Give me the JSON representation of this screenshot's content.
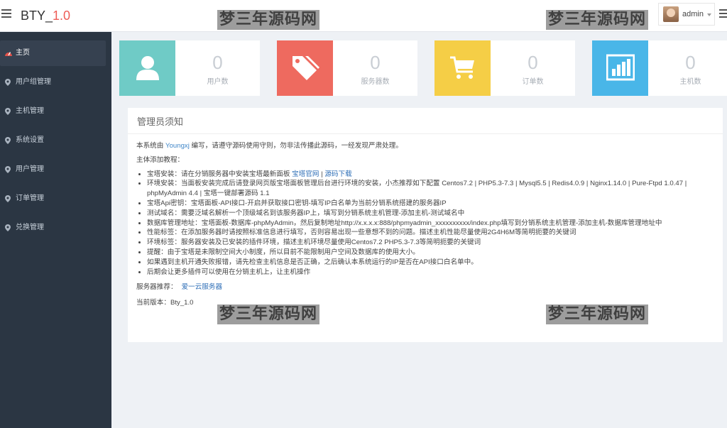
{
  "brand": {
    "name": "BTY_",
    "version": "1.0"
  },
  "user": {
    "name": "admin"
  },
  "watermark": "梦三年源码网",
  "sidebar": {
    "items": [
      {
        "label": "主页",
        "icon": "dashboard-icon",
        "active": true
      },
      {
        "label": "用户组管理",
        "icon": "map-pin-icon"
      },
      {
        "label": "主机管理",
        "icon": "map-pin-icon"
      },
      {
        "label": "系统设置",
        "icon": "map-pin-icon"
      },
      {
        "label": "用户管理",
        "icon": "map-pin-icon"
      },
      {
        "label": "订单管理",
        "icon": "map-pin-icon"
      },
      {
        "label": "兑换管理",
        "icon": "map-pin-icon"
      }
    ]
  },
  "stats": [
    {
      "value": "0",
      "label": "用户数",
      "color": "#6fcbc6",
      "icon": "user-icon"
    },
    {
      "value": "0",
      "label": "服务器数",
      "color": "#ee6a5f",
      "icon": "tags-icon"
    },
    {
      "value": "0",
      "label": "订单数",
      "color": "#f5ce46",
      "icon": "cart-icon"
    },
    {
      "value": "0",
      "label": "主机数",
      "color": "#49b6e8",
      "icon": "bar-chart-icon"
    }
  ],
  "notice": {
    "title": "管理员须知",
    "intro_prefix": "本系统由 ",
    "intro_author": "Youngxj",
    "intro_suffix": " 编写，请遵守源码使用守则，勿非法传播此源码，一经发现严肃处理。",
    "tutorial_heading": "主体添加教程：",
    "item1_text": "宝塔安装：请在分销服务器中安装宝塔最新面板 ",
    "item1_link1": "宝塔官网",
    "item1_sep": " | ",
    "item1_link2": "源码下载",
    "item2": "环境安装：当面板安装完成后请登录网页版宝塔面板管理后台进行环境的安装，小杰推荐如下配置 Centos7.2 | PHP5.3-7.3 | Mysql5.5 | Redis4.0.9 | Nginx1.14.0 | Pure-Ftpd 1.0.47 | phpMyAdmin 4.4 | 宝塔一键部署源码 1.1",
    "item3": "宝塔Api密钥：宝塔面板-API接口-开启并获取接口密钥-填写IP白名单为当前分销系统搭建的服务器IP",
    "item4": "测试域名：需要泛域名解析一个顶级域名到该服务器IP上，填写到分销系统主机管理-添加主机-测试域名中",
    "item5": "数据库管理地址：宝塔面板-数据库-phpMyAdmin，然后复制地址http://x.x.x.x:888/phpmyadmin_xxxxxxxxxx/index.php填写到分销系统主机管理-添加主机-数据库管理地址中",
    "item6": "性能标签：在添加服务器时请按照标准信息进行填写，否则容易出现一些意想不到的问题。描述主机性能尽量使用2G4H6M等简明扼要的关键词",
    "item7": "环境标签：服务器安装及已安装的插件环境，描述主机环境尽量使用Centos7.2 PHP5.3-7.3等简明扼要的关键词",
    "item8": "提醒：由于宝塔是未限制空间大小制度，所以目前不能限制用户空间及数据库的使用大小。",
    "item9": "如果遇到主机开通失败报错，请先检查主机信息是否正确，之后确认本系统运行的IP是否在API接口白名单中。",
    "item10": "后期会让更多插件可以使用在分销主机上，让主机操作",
    "recommend_label": "服务器推荐：",
    "recommend_link": "爱一云服务器",
    "version_label": "当前版本：",
    "version_value": "Bty_1.0"
  }
}
